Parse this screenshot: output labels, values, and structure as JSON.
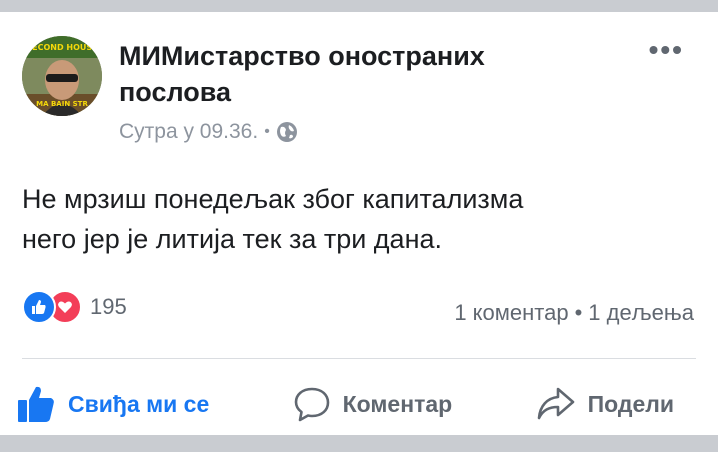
{
  "post": {
    "page_name": "МИМистарство оностраних послова",
    "timestamp": "Сутра у 09.36.",
    "separator": "•",
    "privacy_icon": "globe-icon",
    "more_label": "•••",
    "text_line1": "Не мрзиш понедељак због капитализма",
    "text_line2": "него јер је литија тек за три дана.",
    "avatar_text_top": "SECOND HOUSE",
    "avatar_text_bottom": "MA BAIN STR"
  },
  "engagement": {
    "reaction_count": "195",
    "reaction_icons": [
      "like-icon",
      "love-icon"
    ],
    "comments": "1 коментар",
    "dot": "•",
    "shares": "1 дељења"
  },
  "actions": {
    "like_label": "Свиђа ми се",
    "comment_label": "Коментар",
    "share_label": "Подели"
  },
  "colors": {
    "accent": "#1877f2",
    "love": "#f33e58",
    "muted": "#606770",
    "text": "#1c1e21"
  }
}
